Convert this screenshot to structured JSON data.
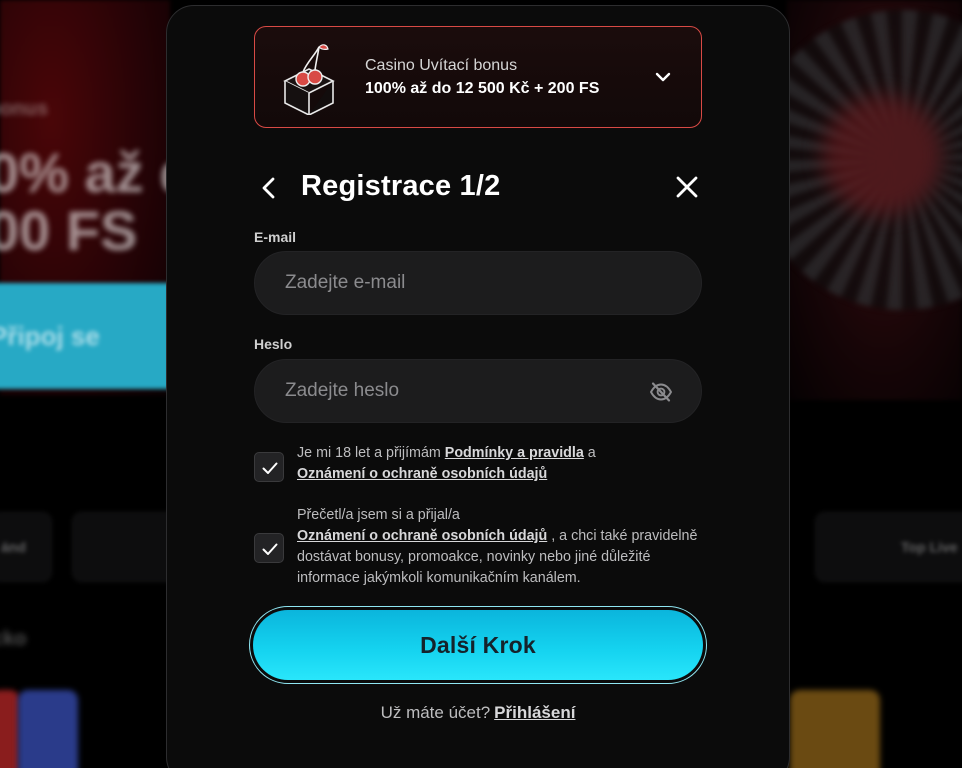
{
  "background": {
    "hero_line1": "bonus",
    "hero_line2": "0% až d",
    "hero_line3": "00 FS",
    "cta_label": "Připoj se",
    "chip_left": "ánd",
    "chip_right": "Top Live",
    "section_heading": "cko"
  },
  "bonus": {
    "label": "Casino Uvítací bonus",
    "value": "100% až do 12 500 Kč + 200 FS",
    "icon": "cherry-box-icon",
    "border_color": "#d84a45"
  },
  "header": {
    "title": "Registrace 1/2"
  },
  "form": {
    "email_label": "E-mail",
    "email_placeholder": "Zadejte e-mail",
    "email_value": "",
    "password_label": "Heslo",
    "password_placeholder": "Zadejte heslo",
    "password_value": ""
  },
  "consents": {
    "terms": {
      "checked": true,
      "text_before": "Je mi 18 let a přijímám ",
      "link1": "Podmínky a pravidla",
      "text_mid": " a ",
      "link2": "Oznámení o ochraně osobních údajů"
    },
    "marketing": {
      "checked": true,
      "text_before": "Přečetl/a jsem si a přijal/a ",
      "link": "Oznámení o ochraně osobních údajů",
      "text_after": " , a chci také pravidelně dostávat bonusy, promoakce, novinky nebo jiné důležité informace jakýmkoli komunikačním kanálem."
    }
  },
  "actions": {
    "next_label": "Další Krok",
    "login_prompt": "Už máte účet?",
    "login_link": "Přihlášení"
  },
  "colors": {
    "accent": "#14d2ef",
    "modal_bg": "#0b0b0b",
    "field_bg": "#1c1c1d"
  }
}
